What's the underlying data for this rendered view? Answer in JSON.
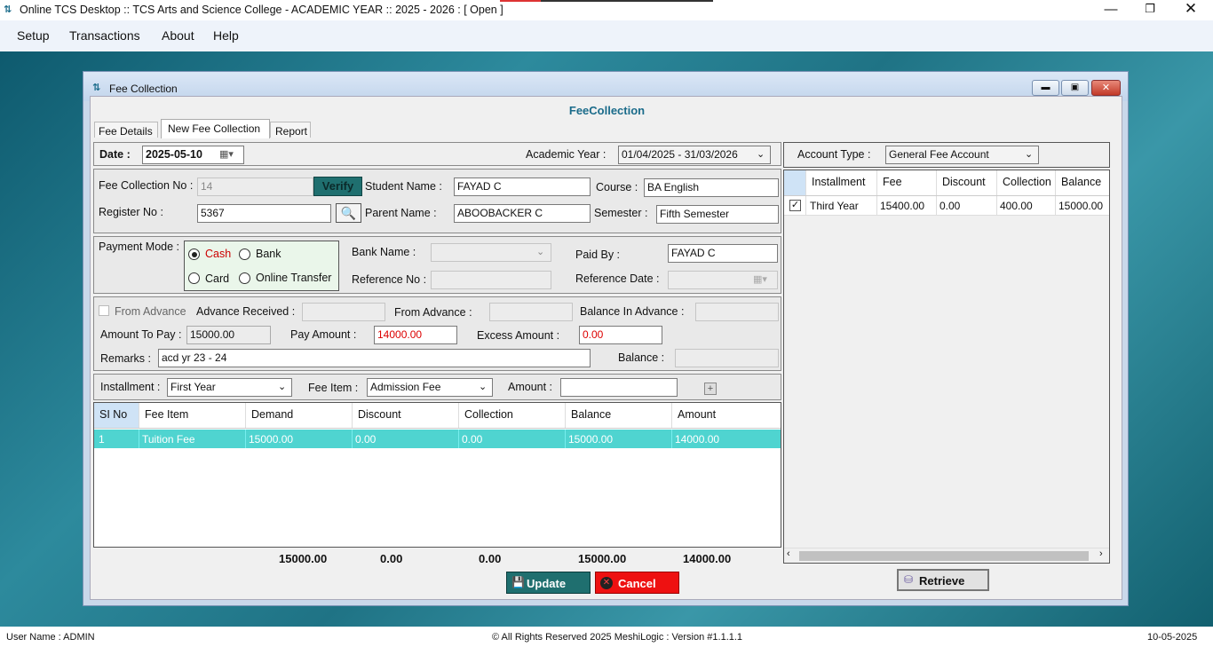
{
  "window": {
    "title": "Online TCS Desktop ::  TCS Arts and Science College  - ACADEMIC YEAR :: 2025 - 2026 : [ Open  ]"
  },
  "menu": [
    "Setup",
    "Transactions",
    "About",
    "Help"
  ],
  "child_window": {
    "title": "Fee Collection",
    "heading": "FeeCollection"
  },
  "tabs": [
    "Fee Details",
    "New Fee Collection",
    "Report"
  ],
  "form": {
    "date_label": "Date :",
    "date": "2025-05-10",
    "academic_year_label": "Academic Year  :",
    "academic_year": "01/04/2025 - 31/03/2026",
    "fee_collection_no_label": "Fee Collection No :",
    "fee_collection_no": "14",
    "verify_label": "Verify",
    "student_name_label": "Student Name :",
    "student_name": "FAYAD C",
    "course_label": "Course :",
    "course": "BA English",
    "register_no_label": "Register No :",
    "register_no": "5367",
    "parent_name_label": "Parent Name :",
    "parent_name": "ABOOBACKER C",
    "semester_label": "Semester :",
    "semester": "Fifth Semester",
    "payment_mode_label": "Payment Mode :",
    "payment_modes": [
      "Cash",
      "Bank",
      "Card",
      "Online Transfer"
    ],
    "bank_name_label": "Bank Name :",
    "paid_by_label": "Paid By :",
    "paid_by": "FAYAD C",
    "reference_no_label": "Reference No :",
    "reference_date_label": "Reference Date :",
    "from_advance_check_label": "From Advance",
    "advance_received_label": "Advance Received :",
    "from_advance_label": "From Advance :",
    "balance_in_advance_label": "Balance In Advance :",
    "amount_to_pay_label": "Amount To Pay :",
    "amount_to_pay": "15000.00",
    "pay_amount_label": "Pay Amount :",
    "pay_amount": "14000.00",
    "excess_amount_label": "Excess Amount :",
    "excess_amount": "0.00",
    "remarks_label": "Remarks :",
    "remarks": "acd yr 23 - 24",
    "balance_label": "Balance :",
    "installment_label": "Installment :",
    "installment": "First Year",
    "fee_item_label": "Fee Item :",
    "fee_item": "Admission Fee",
    "amount_label": "Amount :"
  },
  "fee_grid": {
    "headers": [
      "SI No",
      "Fee Item",
      "Demand",
      "Discount",
      "Collection",
      "Balance",
      "Amount"
    ],
    "rows": [
      [
        "1",
        "Tuition Fee",
        "15000.00",
        "0.00",
        "0.00",
        "15000.00",
        "14000.00"
      ]
    ],
    "totals": [
      "15000.00",
      "0.00",
      "0.00",
      "15000.00",
      "14000.00"
    ]
  },
  "account": {
    "type_label": "Account Type  :",
    "type": "General Fee Account",
    "headers": [
      "Installment",
      "Fee",
      "Discount",
      "Collection",
      "Balance"
    ],
    "rows": [
      [
        "Third Year",
        "15400.00",
        "0.00",
        "400.00",
        "15000.00"
      ]
    ]
  },
  "buttons": {
    "update": "Update",
    "cancel": "Cancel",
    "retrieve": "Retrieve"
  },
  "status": {
    "user": "User Name  :  ADMIN",
    "copyright": "© All Rights Reserved  2025   MeshiLogic : Version #1.1.1.1",
    "date": "10-05-2025"
  },
  "colors": {
    "accent": "#1f6f6f",
    "teal_row": "#4fd4d0",
    "cancel": "#ee1111",
    "heading": "#1a6b8a"
  }
}
